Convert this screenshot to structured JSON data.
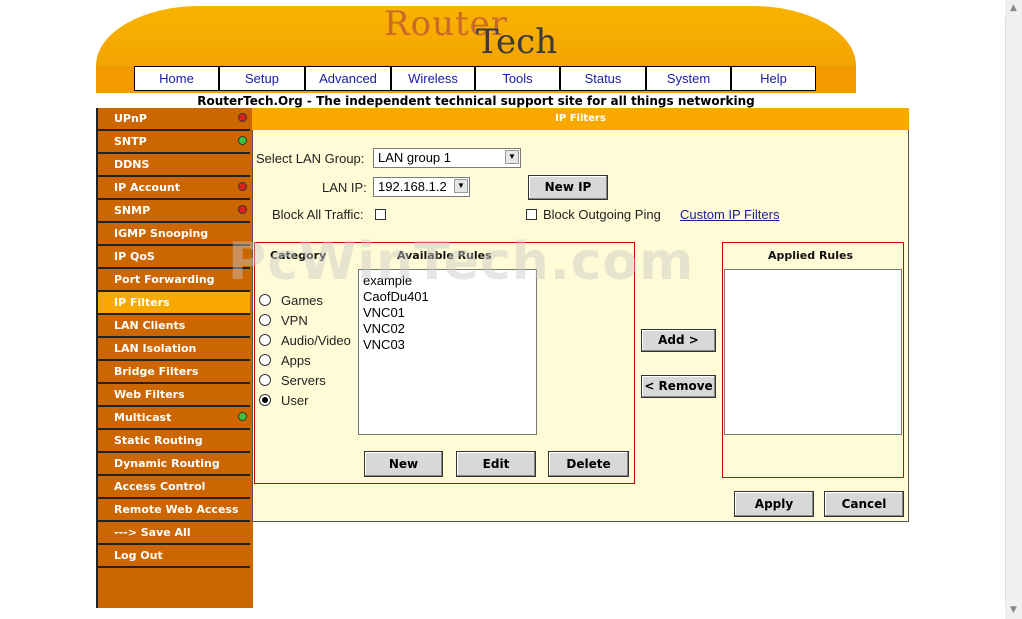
{
  "logo": {
    "part1": "Rou",
    "part2": "ter",
    "part3": "Tech"
  },
  "nav": [
    "Home",
    "Setup",
    "Advanced",
    "Wireless",
    "Tools",
    "Status",
    "System",
    "Help"
  ],
  "tagline": "RouterTech.Org - The independent technical support site for all things networking",
  "sidebar": [
    {
      "label": "UPnP",
      "status": "red"
    },
    {
      "label": "SNTP",
      "status": "green"
    },
    {
      "label": "DDNS",
      "status": ""
    },
    {
      "label": "IP Account",
      "status": "red"
    },
    {
      "label": "SNMP",
      "status": "red"
    },
    {
      "label": "IGMP Snooping",
      "status": ""
    },
    {
      "label": "IP QoS",
      "status": ""
    },
    {
      "label": "Port Forwarding",
      "status": ""
    },
    {
      "label": "IP Filters",
      "status": "",
      "active": true
    },
    {
      "label": "LAN Clients",
      "status": ""
    },
    {
      "label": "LAN Isolation",
      "status": ""
    },
    {
      "label": "Bridge Filters",
      "status": ""
    },
    {
      "label": "Web Filters",
      "status": ""
    },
    {
      "label": "Multicast",
      "status": "green"
    },
    {
      "label": "Static Routing",
      "status": ""
    },
    {
      "label": "Dynamic Routing",
      "status": ""
    },
    {
      "label": "Access Control",
      "status": ""
    },
    {
      "label": "Remote Web Access",
      "status": ""
    },
    {
      "label": "---> Save All",
      "status": ""
    },
    {
      "label": "Log Out",
      "status": ""
    }
  ],
  "colors": {
    "accent": "#f9a800",
    "sidebar": "#cc6600",
    "panel": "#fffbd6",
    "link": "#1a1aa6"
  },
  "panel": {
    "title": "IP Filters",
    "select_group_label": "Select LAN Group:",
    "select_group_value": "LAN group 1",
    "lan_ip_label": "LAN IP:",
    "lan_ip_value": "192.168.1.2",
    "new_ip_button": "New IP",
    "block_all_label": "Block All Traffic:",
    "block_outgoing_label": "Block Outgoing Ping",
    "custom_link": "Custom IP Filters",
    "category_header": "Category",
    "available_header": "Available Rules",
    "applied_header": "Applied Rules",
    "categories": [
      {
        "label": "Games",
        "checked": false
      },
      {
        "label": "VPN",
        "checked": false
      },
      {
        "label": "Audio/Video",
        "checked": false
      },
      {
        "label": "Apps",
        "checked": false
      },
      {
        "label": "Servers",
        "checked": false
      },
      {
        "label": "User",
        "checked": true
      }
    ],
    "available_rules": [
      "example",
      "CaofDu401",
      "VNC01",
      "VNC02",
      "VNC03"
    ],
    "new_button": "New",
    "edit_button": "Edit",
    "delete_button": "Delete",
    "add_button": "Add >",
    "remove_button": "< Remove",
    "apply_button": "Apply",
    "cancel_button": "Cancel"
  },
  "watermark": "PcWinTech.com"
}
